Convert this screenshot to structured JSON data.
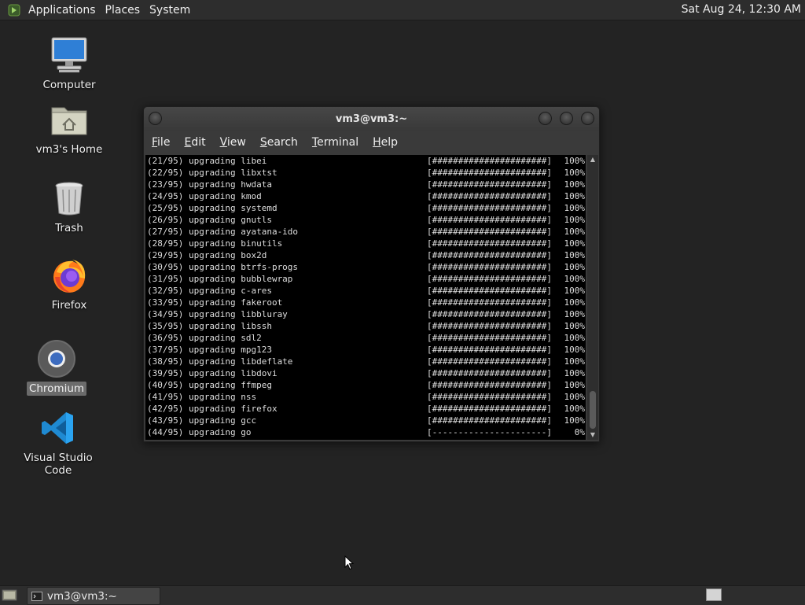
{
  "top_panel": {
    "menus": [
      "Applications",
      "Places",
      "System"
    ],
    "clock": "Sat Aug 24, 12:30 AM"
  },
  "desktop": {
    "icons": [
      {
        "label": "Computer",
        "icon": "computer-icon"
      },
      {
        "label": "vm3's Home",
        "icon": "home-folder-icon"
      },
      {
        "label": "Trash",
        "icon": "trash-icon"
      },
      {
        "label": "Firefox",
        "icon": "firefox-icon"
      },
      {
        "label": "Chromium",
        "icon": "chromium-icon",
        "selected": true
      },
      {
        "label": "Visual Studio Code",
        "icon": "vscode-icon"
      }
    ]
  },
  "terminal": {
    "title": "vm3@vm3:~",
    "menu": [
      {
        "key": "F",
        "rest": "ile"
      },
      {
        "key": "E",
        "rest": "dit"
      },
      {
        "key": "V",
        "rest": "iew"
      },
      {
        "key": "S",
        "rest": "earch"
      },
      {
        "key": "T",
        "rest": "erminal"
      },
      {
        "key": "H",
        "rest": "elp"
      }
    ],
    "lines": [
      {
        "text": "(21/95) upgrading libei",
        "bar": "[######################]",
        "pct": "100%"
      },
      {
        "text": "(22/95) upgrading libxtst",
        "bar": "[######################]",
        "pct": "100%"
      },
      {
        "text": "(23/95) upgrading hwdata",
        "bar": "[######################]",
        "pct": "100%"
      },
      {
        "text": "(24/95) upgrading kmod",
        "bar": "[######################]",
        "pct": "100%"
      },
      {
        "text": "(25/95) upgrading systemd",
        "bar": "[######################]",
        "pct": "100%"
      },
      {
        "text": "(26/95) upgrading gnutls",
        "bar": "[######################]",
        "pct": "100%"
      },
      {
        "text": "(27/95) upgrading ayatana-ido",
        "bar": "[######################]",
        "pct": "100%"
      },
      {
        "text": "(28/95) upgrading binutils",
        "bar": "[######################]",
        "pct": "100%"
      },
      {
        "text": "(29/95) upgrading box2d",
        "bar": "[######################]",
        "pct": "100%"
      },
      {
        "text": "(30/95) upgrading btrfs-progs",
        "bar": "[######################]",
        "pct": "100%"
      },
      {
        "text": "(31/95) upgrading bubblewrap",
        "bar": "[######################]",
        "pct": "100%"
      },
      {
        "text": "(32/95) upgrading c-ares",
        "bar": "[######################]",
        "pct": "100%"
      },
      {
        "text": "(33/95) upgrading fakeroot",
        "bar": "[######################]",
        "pct": "100%"
      },
      {
        "text": "(34/95) upgrading libbluray",
        "bar": "[######################]",
        "pct": "100%"
      },
      {
        "text": "(35/95) upgrading libssh",
        "bar": "[######################]",
        "pct": "100%"
      },
      {
        "text": "(36/95) upgrading sdl2",
        "bar": "[######################]",
        "pct": "100%"
      },
      {
        "text": "(37/95) upgrading mpg123",
        "bar": "[######################]",
        "pct": "100%"
      },
      {
        "text": "(38/95) upgrading libdeflate",
        "bar": "[######################]",
        "pct": "100%"
      },
      {
        "text": "(39/95) upgrading libdovi",
        "bar": "[######################]",
        "pct": "100%"
      },
      {
        "text": "(40/95) upgrading ffmpeg",
        "bar": "[######################]",
        "pct": "100%"
      },
      {
        "text": "(41/95) upgrading nss",
        "bar": "[######################]",
        "pct": "100%"
      },
      {
        "text": "(42/95) upgrading firefox",
        "bar": "[######################]",
        "pct": "100%"
      },
      {
        "text": "(43/95) upgrading gcc",
        "bar": "[######################]",
        "pct": "100%"
      },
      {
        "text": "(44/95) upgrading go",
        "bar": "[----------------------]",
        "pct": "0%"
      }
    ]
  },
  "taskbar": {
    "window_button": "vm3@vm3:~"
  },
  "colors": {
    "desktop_bg": "#232323",
    "panel_bg": "#2d2d2d",
    "terminal_bg": "#000000",
    "terminal_fg": "#dedede"
  }
}
